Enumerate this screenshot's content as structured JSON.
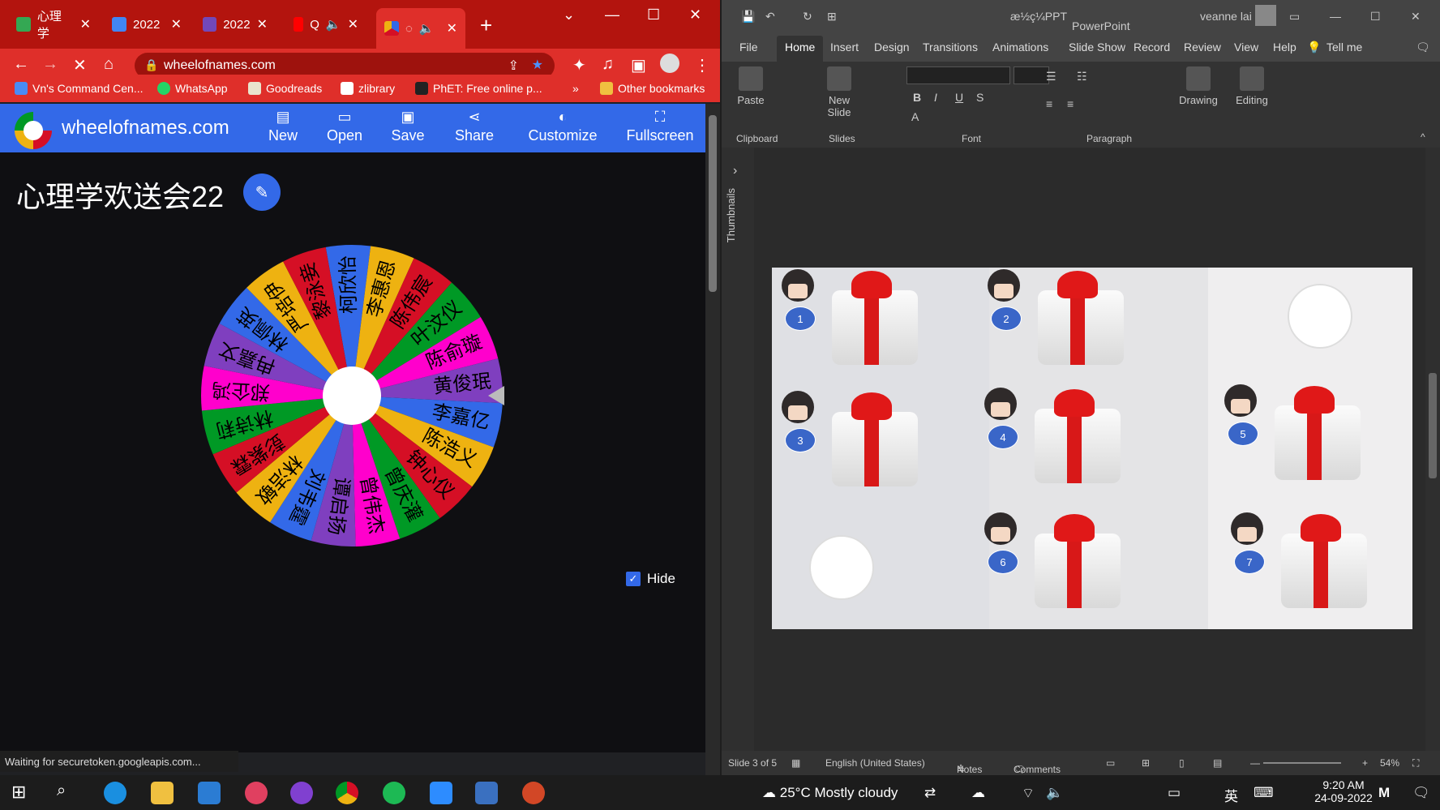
{
  "chrome": {
    "tabs": [
      {
        "label": "心理学",
        "icon": "google-drive-icon",
        "color": "#34a853"
      },
      {
        "label": "2022",
        "icon": "google-docs-icon",
        "color": "#4285f4"
      },
      {
        "label": "2022",
        "icon": "google-forms-icon",
        "color": "#7248b9"
      },
      {
        "label": "Q",
        "icon": "youtube-icon",
        "color": "#ff0000"
      },
      {
        "label": "",
        "icon": "wheel-icon",
        "color": "#ffffff"
      }
    ],
    "url": "wheelofnames.com",
    "bookmarks": [
      "Vn's Command Cen...",
      "WhatsApp",
      "Goodreads",
      "zlibrary",
      "PhET: Free online p..."
    ],
    "other_bookmarks": "Other bookmarks",
    "status": "Waiting for securetoken.googleapis.com..."
  },
  "site": {
    "name": "wheelofnames.com",
    "menu": [
      "New",
      "Open",
      "Save",
      "Share",
      "Customize",
      "Fullscreen"
    ],
    "wheel_title": "心理学欢送会22",
    "hide_label": "Hide",
    "names": [
      "柯欣怡",
      "李惠恩",
      "陈伟宸",
      "叶汶仪",
      "陈俞璇",
      "黄俊珉",
      "李嘉亿",
      "陈浩义",
      "钟心仪",
      "曾庆灌",
      "曾伟杰",
      "谭启扬",
      "刘韦霆",
      "林洁敏",
      "彭紫霖",
      "林诗莉",
      "郑企鸿",
      "冉嘉文",
      "林佩英",
      "严培伊",
      "黎泳妾"
    ],
    "colors": [
      "#3369e8",
      "#eeb211",
      "#d50f25",
      "#009925",
      "#ff00cc",
      "#7f3fbf"
    ]
  },
  "ppt": {
    "title_file": "æ½ç¼PPT",
    "app": "PowerPoint",
    "user": "veanne lai",
    "tabs": [
      "File",
      "Home",
      "Insert",
      "Design",
      "Transitions",
      "Animations",
      "Slide Show",
      "Record",
      "Review",
      "View",
      "Help",
      "Tell me"
    ],
    "groups": [
      "Clipboard",
      "Slides",
      "Font",
      "Paragraph"
    ],
    "paste_label": "Paste",
    "new_slide_label": "New Slide",
    "drawing_label": "Drawing",
    "editing_label": "Editing",
    "thumbnails_label": "Thumbnails",
    "slide_info": "Slide 3 of 5",
    "language": "English (United States)",
    "notes": "Notes",
    "comments": "Comments",
    "zoom": "54%",
    "gift_numbers": [
      "1",
      "2",
      "3",
      "4",
      "5",
      "6",
      "7"
    ]
  },
  "taskbar": {
    "weather": "25°C  Mostly cloudy",
    "ime": "英",
    "time": "9:20 AM",
    "date": "24-09-2022"
  }
}
